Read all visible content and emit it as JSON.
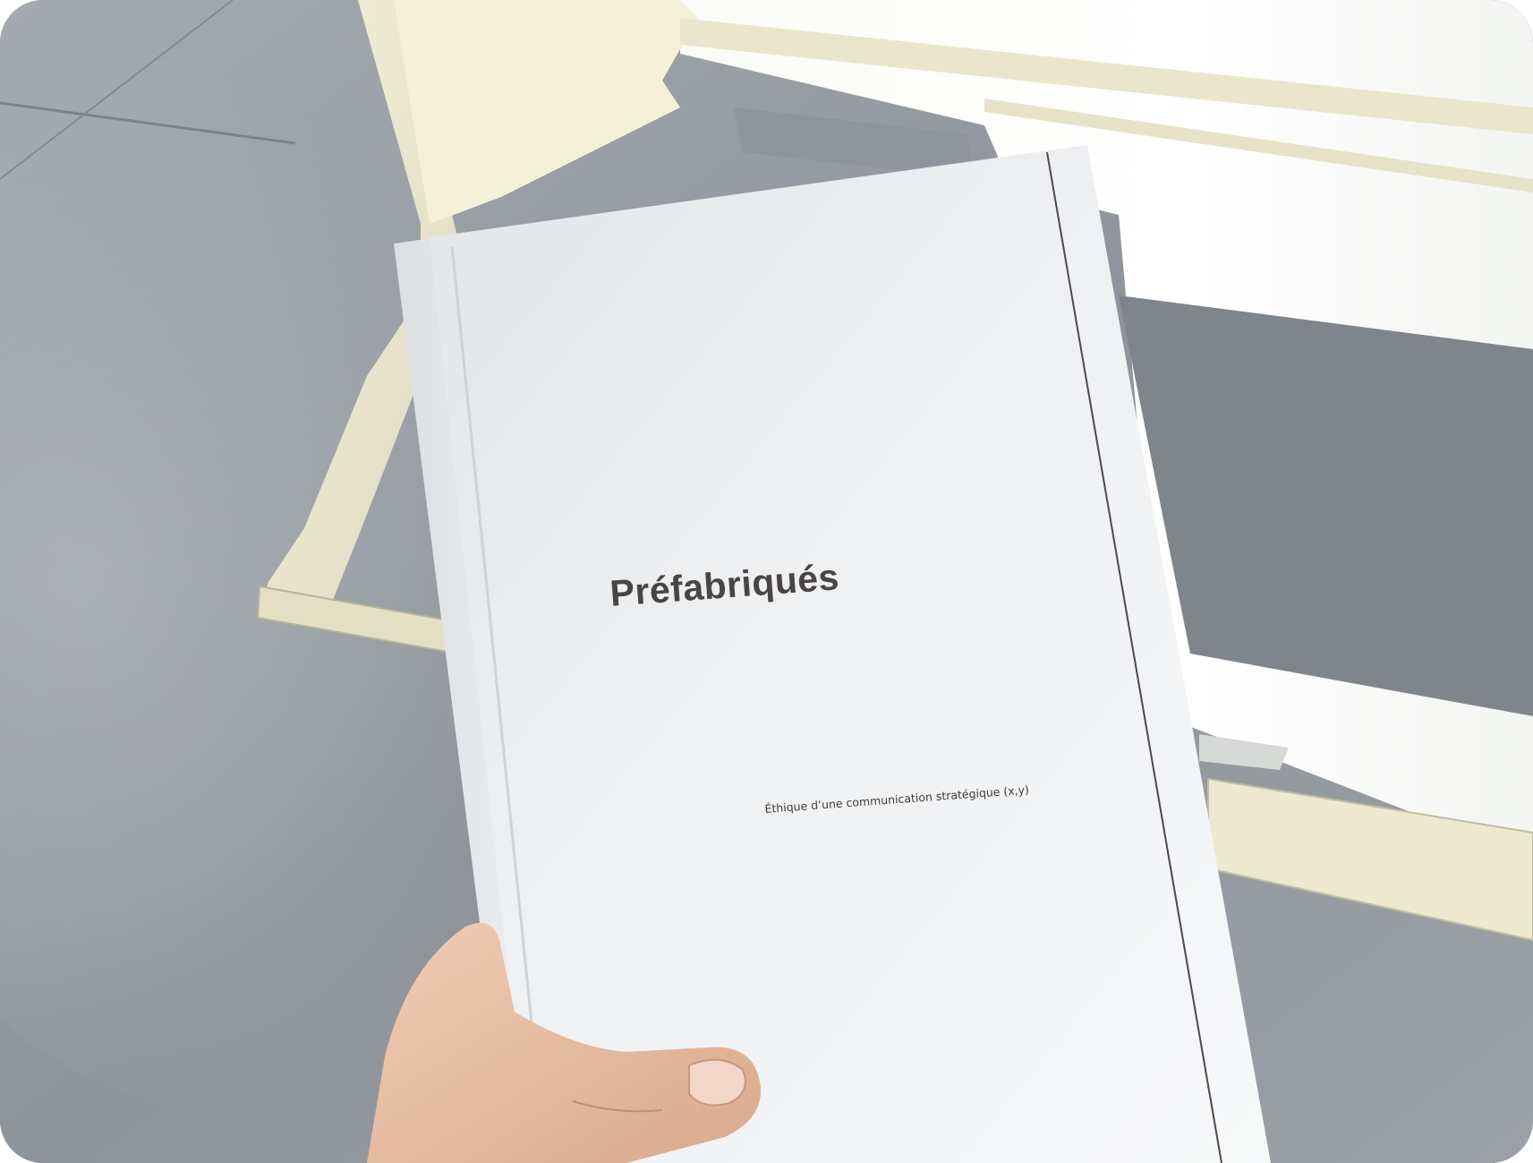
{
  "photo": {
    "subject": "hand holding a white paperback book",
    "colors": {
      "floor": "#8f959b",
      "table_frame": "#ebe8cf",
      "book_cover": "#eceef0",
      "title_ink": "#4a4544",
      "skin": "#e7c2a8"
    }
  },
  "book": {
    "title": "Préfabriqués",
    "subtitle": "Éthique d’une communication stratégique (x,y)"
  }
}
